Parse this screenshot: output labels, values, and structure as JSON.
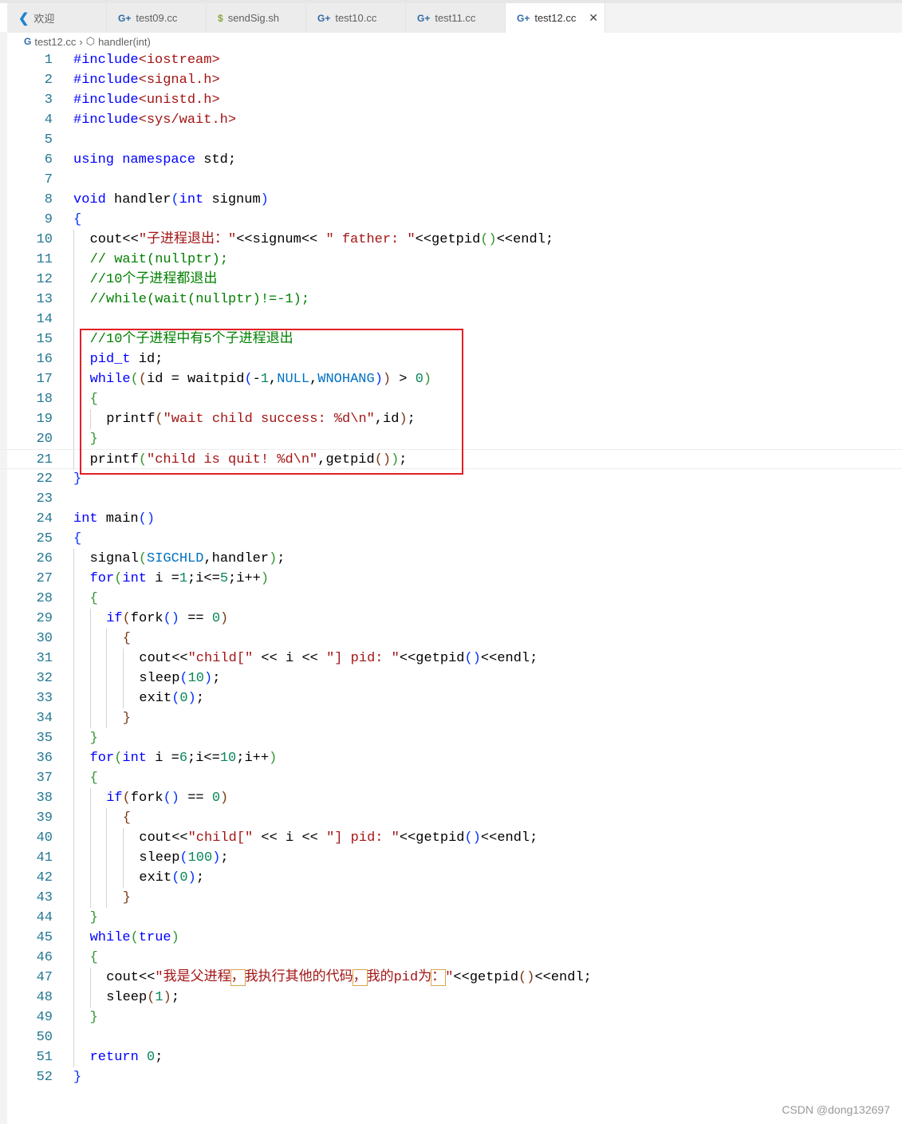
{
  "tabs": [
    {
      "label": "欢迎",
      "icon": "vscode-logo-icon"
    },
    {
      "label": "test09.cc",
      "icon": "cpp-file-icon"
    },
    {
      "label": "sendSig.sh",
      "icon": "shell-file-icon"
    },
    {
      "label": "test10.cc",
      "icon": "cpp-file-icon"
    },
    {
      "label": "test11.cc",
      "icon": "cpp-file-icon"
    },
    {
      "label": "test12.cc",
      "icon": "cpp-file-icon",
      "active": true
    }
  ],
  "breadcrumb": {
    "file": "test12.cc",
    "symbol": "handler(int)"
  },
  "current_line": 21,
  "colors": {
    "keyword": "#0000ff",
    "string": "#a31515",
    "comment": "#008000",
    "number": "#098658",
    "highlight_box": "#e41e26"
  },
  "lines": [
    {
      "i": 0,
      "t": [
        [
          "#include",
          "k"
        ],
        [
          "<iostream>",
          "s"
        ]
      ]
    },
    {
      "i": 0,
      "t": [
        [
          "#include",
          "k"
        ],
        [
          "<signal.h>",
          "s"
        ]
      ]
    },
    {
      "i": 0,
      "t": [
        [
          "#include",
          "k"
        ],
        [
          "<unistd.h>",
          "s"
        ]
      ]
    },
    {
      "i": 0,
      "t": [
        [
          "#include",
          "k"
        ],
        [
          "<sys/wait.h>",
          "s"
        ]
      ]
    },
    {
      "i": 0,
      "t": []
    },
    {
      "i": 0,
      "t": [
        [
          "using",
          "k"
        ],
        [
          " "
        ],
        [
          "namespace",
          "k"
        ],
        [
          " std;"
        ]
      ]
    },
    {
      "i": 0,
      "t": []
    },
    {
      "i": 0,
      "t": [
        [
          "void",
          "k"
        ],
        [
          " handler"
        ],
        [
          "(",
          "b1"
        ],
        [
          "int",
          "k"
        ],
        [
          " signum"
        ],
        [
          ")",
          "b1"
        ]
      ]
    },
    {
      "i": 0,
      "t": [
        [
          "{",
          "b1"
        ]
      ]
    },
    {
      "i": 1,
      "t": [
        [
          "cout<<"
        ],
        [
          "\"子进程退出：\"",
          "s"
        ],
        [
          "<<signum<< "
        ],
        [
          "\" father: \"",
          "s"
        ],
        [
          "<<getpid"
        ],
        [
          "()",
          "b2"
        ],
        [
          "<<endl;"
        ]
      ]
    },
    {
      "i": 1,
      "t": [
        [
          "// wait(nullptr);",
          "c"
        ]
      ]
    },
    {
      "i": 1,
      "t": [
        [
          "//10个子进程都退出",
          "c"
        ]
      ]
    },
    {
      "i": 1,
      "t": [
        [
          "//while(wait(nullptr)!=-1);",
          "c"
        ]
      ]
    },
    {
      "i": 1,
      "t": []
    },
    {
      "i": 1,
      "t": [
        [
          "//10个子进程中有5个子进程退出",
          "c"
        ]
      ]
    },
    {
      "i": 1,
      "t": [
        [
          "pid_t",
          "k"
        ],
        [
          " id;"
        ]
      ]
    },
    {
      "i": 1,
      "t": [
        [
          "while",
          "k"
        ],
        [
          "(",
          "b2"
        ],
        [
          "(",
          "b3"
        ],
        [
          "id = waitpid"
        ],
        [
          "(",
          "b1"
        ],
        [
          "-"
        ],
        [
          "1",
          "n"
        ],
        [
          ","
        ],
        [
          "NULL",
          "m"
        ],
        [
          ","
        ],
        [
          "WNOHANG",
          "m"
        ],
        [
          ")",
          "b1"
        ],
        [
          ")",
          "b3"
        ],
        [
          " > "
        ],
        [
          "0",
          "n"
        ],
        [
          ")",
          "b2"
        ]
      ]
    },
    {
      "i": 1,
      "t": [
        [
          "{",
          "b2"
        ]
      ]
    },
    {
      "i": 2,
      "t": [
        [
          "printf"
        ],
        [
          "(",
          "b3"
        ],
        [
          "\"wait child success: %d\\n\"",
          "s"
        ],
        [
          ",id"
        ],
        [
          ")",
          "b3"
        ],
        [
          ";"
        ]
      ]
    },
    {
      "i": 1,
      "t": [
        [
          "}",
          "b2"
        ]
      ]
    },
    {
      "i": 1,
      "t": [
        [
          "printf"
        ],
        [
          "(",
          "b2"
        ],
        [
          "\"child is quit! %d\\n\"",
          "s"
        ],
        [
          ",getpid"
        ],
        [
          "()",
          "b3"
        ],
        [
          ")",
          "b2"
        ],
        [
          ";"
        ]
      ]
    },
    {
      "i": 0,
      "t": [
        [
          "}",
          "b1"
        ]
      ]
    },
    {
      "i": 0,
      "t": []
    },
    {
      "i": 0,
      "t": [
        [
          "int",
          "k"
        ],
        [
          " main"
        ],
        [
          "()",
          "b1"
        ]
      ]
    },
    {
      "i": 0,
      "t": [
        [
          "{",
          "b1"
        ]
      ]
    },
    {
      "i": 1,
      "t": [
        [
          "signal"
        ],
        [
          "(",
          "b2"
        ],
        [
          "SIGCHLD",
          "m"
        ],
        [
          ",handler"
        ],
        [
          ")",
          "b2"
        ],
        [
          ";"
        ]
      ]
    },
    {
      "i": 1,
      "t": [
        [
          "for",
          "k"
        ],
        [
          "(",
          "b2"
        ],
        [
          "int",
          "k"
        ],
        [
          " i ="
        ],
        [
          "1",
          "n"
        ],
        [
          ";i<="
        ],
        [
          "5",
          "n"
        ],
        [
          ";i++"
        ],
        [
          ")",
          "b2"
        ]
      ]
    },
    {
      "i": 1,
      "t": [
        [
          "{",
          "b2"
        ]
      ]
    },
    {
      "i": 2,
      "t": [
        [
          "if",
          "k"
        ],
        [
          "(",
          "b3"
        ],
        [
          "fork"
        ],
        [
          "()",
          "b1"
        ],
        [
          " == "
        ],
        [
          "0",
          "n"
        ],
        [
          ")",
          "b3"
        ]
      ]
    },
    {
      "i": 3,
      "t": [
        [
          "{",
          "b3"
        ]
      ]
    },
    {
      "i": 4,
      "t": [
        [
          "cout<<"
        ],
        [
          "\"child[\"",
          "s"
        ],
        [
          " << i << "
        ],
        [
          "\"] pid: \"",
          "s"
        ],
        [
          "<<getpid"
        ],
        [
          "()",
          "b1"
        ],
        [
          "<<endl;"
        ]
      ]
    },
    {
      "i": 4,
      "t": [
        [
          "sleep"
        ],
        [
          "(",
          "b1"
        ],
        [
          "10",
          "n"
        ],
        [
          ")",
          "b1"
        ],
        [
          ";"
        ]
      ]
    },
    {
      "i": 4,
      "t": [
        [
          "exit"
        ],
        [
          "(",
          "b1"
        ],
        [
          "0",
          "n"
        ],
        [
          ")",
          "b1"
        ],
        [
          ";"
        ]
      ]
    },
    {
      "i": 3,
      "t": [
        [
          "}",
          "b3"
        ]
      ]
    },
    {
      "i": 1,
      "t": [
        [
          "}",
          "b2"
        ]
      ]
    },
    {
      "i": 1,
      "t": [
        [
          "for",
          "k"
        ],
        [
          "(",
          "b2"
        ],
        [
          "int",
          "k"
        ],
        [
          " i ="
        ],
        [
          "6",
          "n"
        ],
        [
          ";i<="
        ],
        [
          "10",
          "n"
        ],
        [
          ";i++"
        ],
        [
          ")",
          "b2"
        ]
      ]
    },
    {
      "i": 1,
      "t": [
        [
          "{",
          "b2"
        ]
      ]
    },
    {
      "i": 2,
      "t": [
        [
          "if",
          "k"
        ],
        [
          "(",
          "b3"
        ],
        [
          "fork"
        ],
        [
          "()",
          "b1"
        ],
        [
          " == "
        ],
        [
          "0",
          "n"
        ],
        [
          ")",
          "b3"
        ]
      ]
    },
    {
      "i": 3,
      "t": [
        [
          "{",
          "b3"
        ]
      ]
    },
    {
      "i": 4,
      "t": [
        [
          "cout<<"
        ],
        [
          "\"child[\"",
          "s"
        ],
        [
          " << i << "
        ],
        [
          "\"] pid: \"",
          "s"
        ],
        [
          "<<getpid"
        ],
        [
          "()",
          "b1"
        ],
        [
          "<<endl;"
        ]
      ]
    },
    {
      "i": 4,
      "t": [
        [
          "sleep"
        ],
        [
          "(",
          "b1"
        ],
        [
          "100",
          "n"
        ],
        [
          ")",
          "b1"
        ],
        [
          ";"
        ]
      ]
    },
    {
      "i": 4,
      "t": [
        [
          "exit"
        ],
        [
          "(",
          "b1"
        ],
        [
          "0",
          "n"
        ],
        [
          ")",
          "b1"
        ],
        [
          ";"
        ]
      ]
    },
    {
      "i": 3,
      "t": [
        [
          "}",
          "b3"
        ]
      ]
    },
    {
      "i": 1,
      "t": [
        [
          "}",
          "b2"
        ]
      ]
    },
    {
      "i": 1,
      "t": [
        [
          "while",
          "k"
        ],
        [
          "(",
          "b2"
        ],
        [
          "true",
          "k"
        ],
        [
          ")",
          "b2"
        ]
      ]
    },
    {
      "i": 1,
      "t": [
        [
          "{",
          "b2"
        ]
      ]
    },
    {
      "i": 2,
      "t": [
        [
          "cout<<"
        ],
        [
          "\"我是父进程",
          "s"
        ],
        [
          "，",
          "hl"
        ],
        [
          "我执行其他的代码",
          "s"
        ],
        [
          "，",
          "hl"
        ],
        [
          "我的pid为",
          "s"
        ],
        [
          "：",
          "hl"
        ],
        [
          "\"",
          "s"
        ],
        [
          "<<getpid"
        ],
        [
          "()",
          "b3"
        ],
        [
          "<<endl;"
        ]
      ]
    },
    {
      "i": 2,
      "t": [
        [
          "sleep"
        ],
        [
          "(",
          "b3"
        ],
        [
          "1",
          "n"
        ],
        [
          ")",
          "b3"
        ],
        [
          ";"
        ]
      ]
    },
    {
      "i": 1,
      "t": [
        [
          "}",
          "b2"
        ]
      ]
    },
    {
      "i": 1,
      "t": []
    },
    {
      "i": 1,
      "t": [
        [
          "return",
          "k"
        ],
        [
          " "
        ],
        [
          "0",
          "n"
        ],
        [
          ";"
        ]
      ]
    },
    {
      "i": 0,
      "t": [
        [
          "}",
          "b1"
        ]
      ]
    }
  ],
  "watermark": "CSDN @dong132697"
}
